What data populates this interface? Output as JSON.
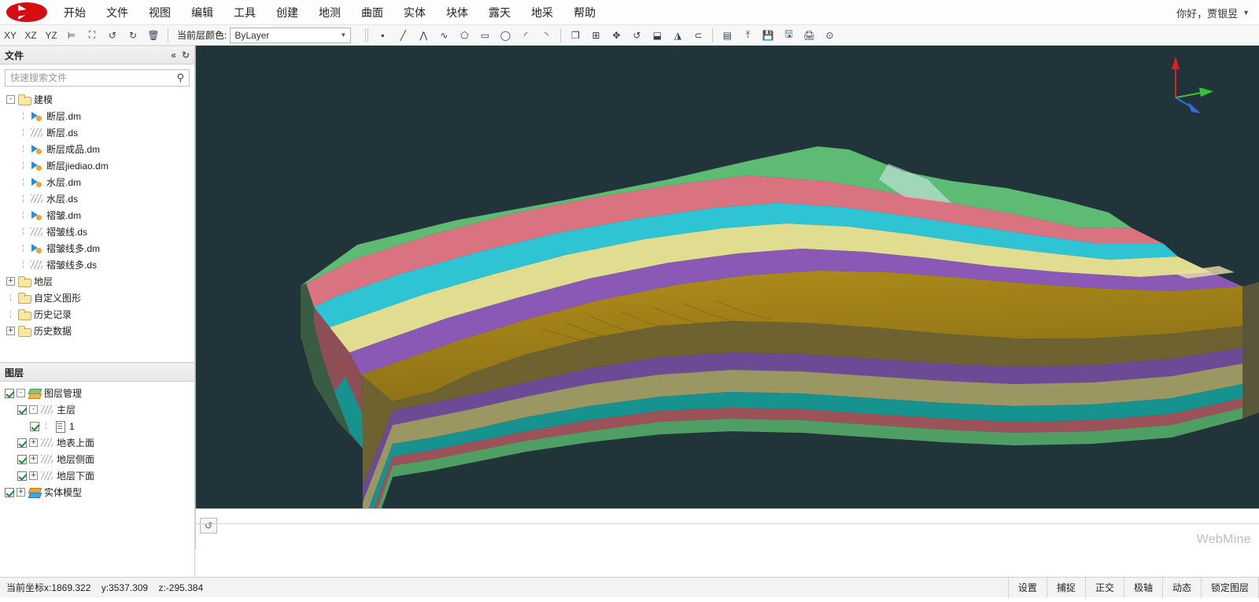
{
  "app": {
    "brand": "WebMine",
    "logo_icon": "k-logo-icon",
    "user_greeting": "你好，贾银昱"
  },
  "menubar": {
    "items": [
      {
        "label": "开始"
      },
      {
        "label": "文件"
      },
      {
        "label": "视图"
      },
      {
        "label": "编辑"
      },
      {
        "label": "工具"
      },
      {
        "label": "创建"
      },
      {
        "label": "地测"
      },
      {
        "label": "曲面"
      },
      {
        "label": "实体"
      },
      {
        "label": "块体"
      },
      {
        "label": "露天"
      },
      {
        "label": "地采"
      },
      {
        "label": "帮助"
      }
    ]
  },
  "toolbar": {
    "view_buttons": [
      {
        "name": "view-xy-button",
        "label": "XY"
      },
      {
        "name": "view-xz-button",
        "label": "XZ"
      },
      {
        "name": "view-yz-button",
        "label": "YZ"
      },
      {
        "name": "view-section-button",
        "label": "⊨"
      },
      {
        "name": "zoom-extents-button",
        "label": "⛶"
      },
      {
        "name": "undo-button",
        "label": "↺"
      },
      {
        "name": "redo-button",
        "label": "↻"
      },
      {
        "name": "delete-button",
        "label": "🗑"
      }
    ],
    "layer_color_label": "当前层颜色:",
    "layer_color_value": "ByLayer",
    "draw_buttons": [
      {
        "name": "point-tool-button",
        "label": "▪"
      },
      {
        "name": "line-tool-button",
        "label": "╱"
      },
      {
        "name": "polyline-tool-button",
        "label": "⋀"
      },
      {
        "name": "spline-tool-button",
        "label": "∿"
      },
      {
        "name": "polygon-tool-button",
        "label": "⬠"
      },
      {
        "name": "rectangle-tool-button",
        "label": "▭"
      },
      {
        "name": "circle-tool-button",
        "label": "◯"
      },
      {
        "name": "arc-tool-button",
        "label": "◜"
      },
      {
        "name": "curve-tool-button",
        "label": "◝"
      }
    ],
    "edit_buttons": [
      {
        "name": "copy-button",
        "label": "❐"
      },
      {
        "name": "array-button",
        "label": "⊞"
      },
      {
        "name": "move-button",
        "label": "✥"
      },
      {
        "name": "rotate-button",
        "label": "↺"
      },
      {
        "name": "scale-button",
        "label": "⬓"
      },
      {
        "name": "mirror-button",
        "label": "◮"
      },
      {
        "name": "offset-button",
        "label": "⊂"
      }
    ],
    "file_buttons": [
      {
        "name": "properties-button",
        "label": "▤"
      },
      {
        "name": "import-button",
        "label": "⤒"
      },
      {
        "name": "save-button",
        "label": "💾"
      },
      {
        "name": "save-as-button",
        "label": "🖫"
      },
      {
        "name": "print-button",
        "label": "🖨"
      },
      {
        "name": "settings-button",
        "label": "⊙"
      }
    ]
  },
  "file_panel": {
    "title": "文件",
    "collapse_icon": "collapse-icon",
    "refresh_icon": "refresh-icon",
    "search": {
      "placeholder": "快速搜索文件",
      "value": "",
      "icon": "search-icon"
    },
    "tree": [
      {
        "label": "建模",
        "icon": "folder-icon",
        "indent": 0,
        "expander": "-"
      },
      {
        "label": "断层.dm",
        "icon": "dm-icon",
        "indent": 1,
        "expander": ""
      },
      {
        "label": "断层.ds",
        "icon": "ds-icon",
        "indent": 1,
        "expander": ""
      },
      {
        "label": "断层成品.dm",
        "icon": "dm-icon",
        "indent": 1,
        "expander": ""
      },
      {
        "label": "断层jiediao.dm",
        "icon": "dm-icon",
        "indent": 1,
        "expander": ""
      },
      {
        "label": "水层.dm",
        "icon": "dm-icon",
        "indent": 1,
        "expander": ""
      },
      {
        "label": "水层.ds",
        "icon": "ds-icon",
        "indent": 1,
        "expander": ""
      },
      {
        "label": "褶皱.dm",
        "icon": "dm-icon",
        "indent": 1,
        "expander": ""
      },
      {
        "label": "褶皱线.ds",
        "icon": "ds-icon",
        "indent": 1,
        "expander": ""
      },
      {
        "label": "褶皱线多.dm",
        "icon": "dm-icon",
        "indent": 1,
        "expander": ""
      },
      {
        "label": "褶皱线多.ds",
        "icon": "ds-icon",
        "indent": 1,
        "expander": ""
      },
      {
        "label": "地层",
        "icon": "folder-icon",
        "indent": 0,
        "expander": "+"
      },
      {
        "label": "自定义图形",
        "icon": "folder-icon",
        "indent": 0,
        "expander": ""
      },
      {
        "label": "历史记录",
        "icon": "folder-icon",
        "indent": 0,
        "expander": ""
      },
      {
        "label": "历史数据",
        "icon": "folder-icon",
        "indent": 0,
        "expander": "+"
      }
    ]
  },
  "layer_panel": {
    "title": "图层",
    "tree": [
      {
        "label": "图层管理",
        "icon": "layers-icon",
        "indent": 0,
        "expander": "-",
        "checked": true
      },
      {
        "label": "主层",
        "icon": "ds-icon",
        "indent": 1,
        "expander": "-",
        "checked": true
      },
      {
        "label": "1",
        "icon": "document-icon",
        "indent": 2,
        "expander": "",
        "checked": true
      },
      {
        "label": "地表上面",
        "icon": "ds-icon",
        "indent": 1,
        "expander": "+",
        "checked": true
      },
      {
        "label": "地层侧面",
        "icon": "ds-icon",
        "indent": 1,
        "expander": "+",
        "checked": true
      },
      {
        "label": "地层下面",
        "icon": "ds-icon",
        "indent": 1,
        "expander": "+",
        "checked": true
      },
      {
        "label": "实体模型",
        "icon": "solid-icon",
        "indent": 0,
        "expander": "+",
        "checked": true
      }
    ]
  },
  "viewport": {
    "background_color": "#21343a",
    "axis_triad": {
      "z_color": "#e02020",
      "y_color": "#37c23a",
      "x_color": "#2f6fe0"
    },
    "model_colors": {
      "surface_green": "#5dbb74",
      "surface_pink": "#d9737f",
      "surface_cyan": "#2ec4d4",
      "surface_yellow": "#e0dc90",
      "surface_purple": "#8a59b5",
      "surface_brown": "#9a7d18",
      "side_olive": "#6e6330",
      "side_purple": "#6c4a96",
      "side_khaki": "#9a9763",
      "side_teal": "#17938f",
      "side_maroon": "#9b5359",
      "side_green": "#4f9e63"
    }
  },
  "command_area": {
    "history_icon": "history-icon"
  },
  "statusbar": {
    "coordinates": "当前坐标x:1869.322    y:3537.309    z:-295.384",
    "buttons": [
      {
        "label": "设置"
      },
      {
        "label": "捕捉"
      },
      {
        "label": "正交"
      },
      {
        "label": "极轴"
      },
      {
        "label": "动态"
      },
      {
        "label": "锁定图层"
      }
    ]
  }
}
